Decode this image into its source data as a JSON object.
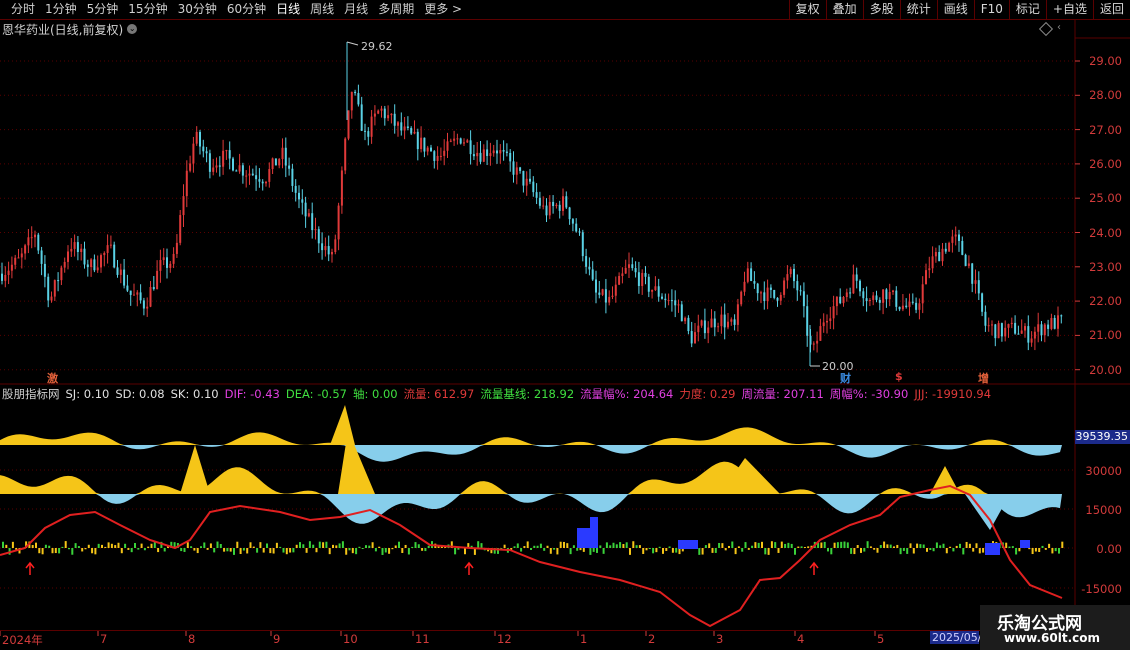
{
  "toolbar": {
    "periods": [
      "分时",
      "1分钟",
      "5分钟",
      "15分钟",
      "30分钟",
      "60分钟",
      "日线",
      "周线",
      "月线",
      "多周期",
      "更多 >"
    ],
    "active": "日线",
    "actions": [
      "复权",
      "叠加",
      "多股",
      "统计",
      "画线",
      "F10",
      "标记",
      "+自选",
      "返回"
    ]
  },
  "chart": {
    "title": "恩华药业(日线,前复权)",
    "high_label": "29.62",
    "low_label": "20.00",
    "price_axis": [
      "29.00",
      "28.00",
      "27.00",
      "26.00",
      "25.00",
      "24.00",
      "23.00",
      "22.00",
      "21.00",
      "20.00"
    ],
    "markers": [
      {
        "text": "激",
        "color": "#e0603a"
      },
      {
        "text": "财",
        "color": "#3a8ae0"
      },
      {
        "text": "$",
        "color": "#e03a3a"
      },
      {
        "text": "增",
        "color": "#e0603a"
      }
    ]
  },
  "indicator": {
    "name": "股朋指标网",
    "values": [
      {
        "label": "SJ: 0.10",
        "color": "#e0e0e0"
      },
      {
        "label": "SD: 0.08",
        "color": "#e0e0e0"
      },
      {
        "label": "SK: 0.10",
        "color": "#e0e0e0"
      },
      {
        "label": "DIF: -0.43",
        "color": "#e040e0"
      },
      {
        "label": "DEA: -0.57",
        "color": "#40e040"
      },
      {
        "label": "轴: 0.00",
        "color": "#40e040"
      },
      {
        "label": "流量: 612.97",
        "color": "#e03a3a"
      },
      {
        "label": "流量基线: 218.92",
        "color": "#40e040"
      },
      {
        "label": "流量幅%: 204.64",
        "color": "#e040e0"
      },
      {
        "label": "力度: 0.29",
        "color": "#e03a3a"
      },
      {
        "label": "周流量: 207.11",
        "color": "#e040e0"
      },
      {
        "label": "周幅%: -30.90",
        "color": "#e040e0"
      },
      {
        "label": "JJJ: -19910.94",
        "color": "#e03a3a"
      }
    ],
    "axis": [
      "30000",
      "15000",
      "0.00",
      "-15000"
    ],
    "current_value": "39539.35"
  },
  "dates": [
    "2024年",
    "7",
    "8",
    "9",
    "10",
    "11",
    "12",
    "1",
    "2",
    "3",
    "4",
    "5"
  ],
  "date_box": "2025/05/",
  "watermark": {
    "line1": "乐淘公式网",
    "line2": "www.60lt.com"
  },
  "colors": {
    "up": "#e03a3a",
    "down": "#5ad2e6",
    "grid": "#5a0000",
    "yellow": "#f5c518",
    "blue": "#87ceeb"
  }
}
